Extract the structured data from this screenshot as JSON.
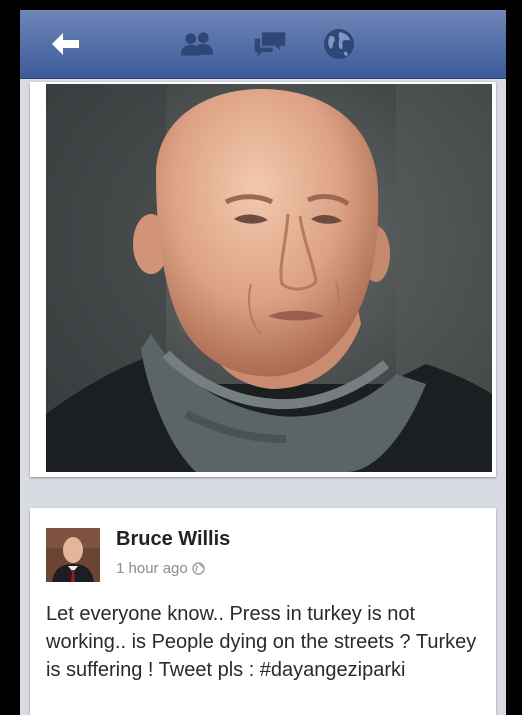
{
  "navbar": {
    "icons": [
      "back-arrow-icon",
      "friends-icon",
      "messages-icon",
      "notifications-globe-icon"
    ],
    "background": "#3c5a98"
  },
  "post": {
    "author": "Bruce Willis",
    "time": "1 hour ago",
    "privacy_icon": "public-globe-icon",
    "text": "Let everyone know.. Press in turkey is not working.. is People dying on the streets ? Turkey is suffering ! Tweet pls : #dayangeziparki"
  }
}
